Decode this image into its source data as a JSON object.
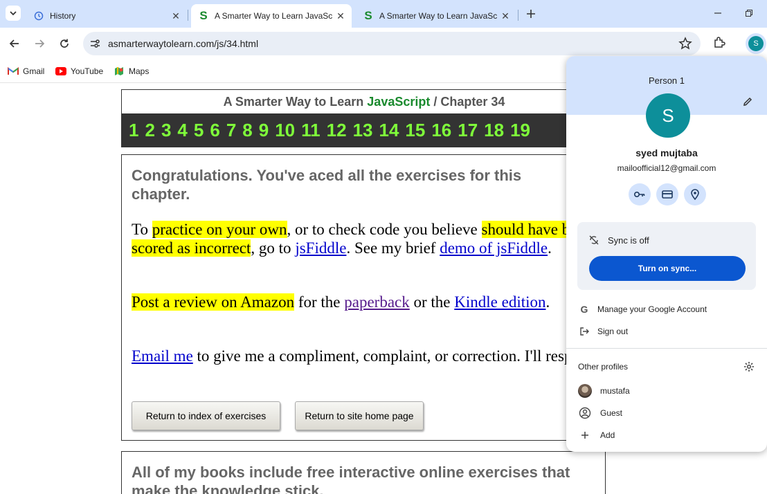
{
  "browser": {
    "tabs": [
      {
        "title": "History",
        "active": false
      },
      {
        "title": "A Smarter Way to Learn JavaScr",
        "active": true
      },
      {
        "title": "A Smarter Way to Learn JavaScr",
        "active": false
      }
    ],
    "url": "asmarterwaytolearn.com/js/34.html",
    "bookmarks": [
      {
        "label": "Gmail",
        "icon": "gmail-icon"
      },
      {
        "label": "YouTube",
        "icon": "youtube-icon"
      },
      {
        "label": "Maps",
        "icon": "maps-icon"
      }
    ],
    "profile_initial": "S"
  },
  "page": {
    "header": {
      "title_prefix": "A Smarter Way to Learn ",
      "title_js": "JavaScript",
      "title_sep": " / ",
      "title_chapter": "Chapter 34"
    },
    "chapter_numbers": [
      "1",
      "2",
      "3",
      "4",
      "5",
      "6",
      "7",
      "8",
      "9",
      "10",
      "11",
      "12",
      "13",
      "14",
      "15",
      "16",
      "17",
      "18",
      "19"
    ],
    "congrats": "Congratulations. You've aced all the exercises for this chapter.",
    "practice": {
      "t1": "To ",
      "h1": "practice on your own",
      "t2": ", or to check code you believe ",
      "h2": "should have been scored as incorrect",
      "t3": ", go to ",
      "l1": "jsFiddle",
      "t4": ". See my brief ",
      "l2": "demo of jsFiddle",
      "t5": "."
    },
    "review": {
      "h1": "Post a review on Amazon",
      "t1": " for the ",
      "l1": "paperback",
      "t2": " or the ",
      "l2": "Kindle edition",
      "t3": "."
    },
    "email": {
      "l1": "Email me",
      "t1": " to give me a compliment, complaint, or correction. I'll respond."
    },
    "buttons": {
      "index": "Return to index of exercises",
      "home": "Return to site home page"
    },
    "books": "All of my books include free interactive online exercises that make the knowledge stick."
  },
  "profile_menu": {
    "person_label": "Person 1",
    "avatar_initial": "S",
    "name": "syed mujtaba",
    "email": "mailoofficial12@gmail.com",
    "sync_status": "Sync is off",
    "sync_button": "Turn on sync...",
    "manage_account": "Manage your Google Account",
    "sign_out": "Sign out",
    "other_profiles_label": "Other profiles",
    "other_profiles": [
      {
        "name": "mustafa",
        "icon": "profile-photo"
      },
      {
        "name": "Guest",
        "icon": "guest-icon"
      },
      {
        "name": "Add",
        "icon": "plus-icon"
      }
    ],
    "accent_color": "#0b57d0",
    "avatar_color": "#0d8f9a"
  }
}
